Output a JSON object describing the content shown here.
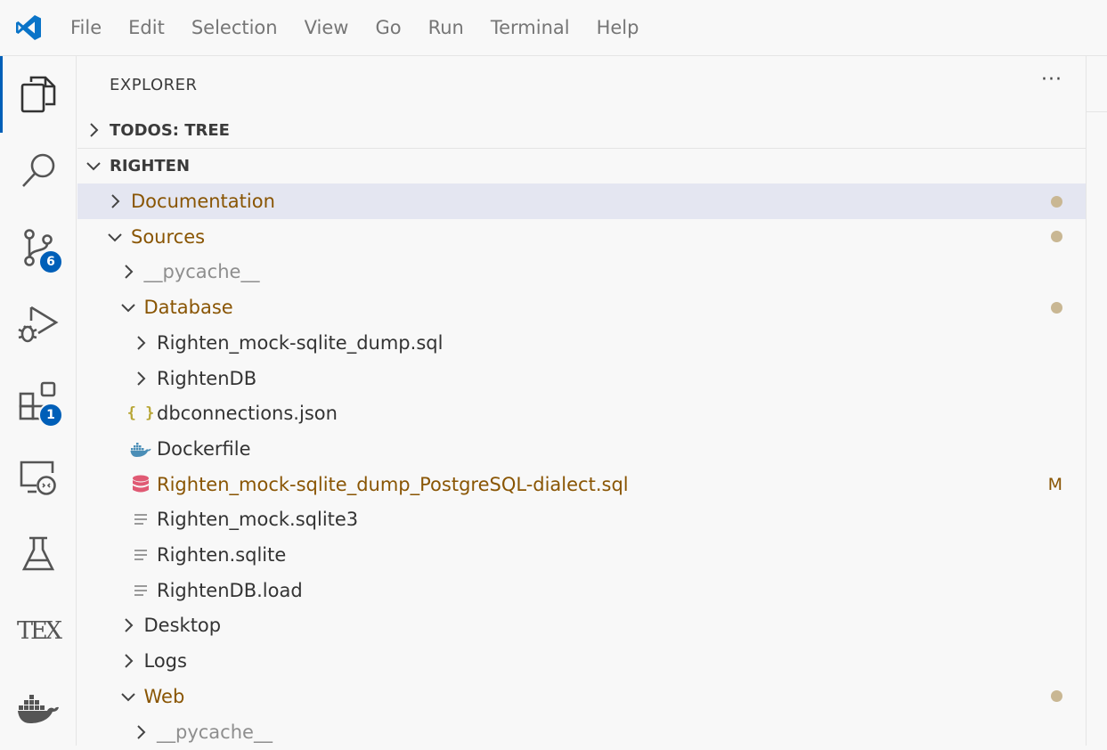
{
  "menu": [
    "File",
    "Edit",
    "Selection",
    "View",
    "Go",
    "Run",
    "Terminal",
    "Help"
  ],
  "activity": {
    "scm_badge": "6",
    "extensions_badge": "1",
    "tex_label": "TEX"
  },
  "sidebar": {
    "title": "EXPLORER",
    "more": "···",
    "sections": {
      "todos": "TODOS: TREE",
      "project": "RIGHTEN"
    }
  },
  "tree": [
    {
      "label": "Documentation",
      "kind": "folder",
      "state": "collapsed",
      "depth": 0,
      "color": "mod",
      "deco": "dot",
      "selected": true
    },
    {
      "label": "Sources",
      "kind": "folder",
      "state": "expanded",
      "depth": 0,
      "color": "mod",
      "deco": "dot"
    },
    {
      "label": "__pycache__",
      "kind": "folder",
      "state": "collapsed",
      "depth": 1,
      "color": "ignored"
    },
    {
      "label": "Database",
      "kind": "folder",
      "state": "expanded",
      "depth": 1,
      "color": "mod",
      "deco": "dot"
    },
    {
      "label": "Righten_mock-sqlite_dump.sql",
      "kind": "folder",
      "state": "collapsed",
      "depth": 2,
      "color": "normal"
    },
    {
      "label": "RightenDB",
      "kind": "folder",
      "state": "collapsed",
      "depth": 2,
      "color": "normal"
    },
    {
      "label": "dbconnections.json",
      "kind": "file",
      "icon": "json-icon",
      "depth": 2,
      "color": "normal"
    },
    {
      "label": "Dockerfile",
      "kind": "file",
      "icon": "docker-file-icon",
      "depth": 2,
      "color": "normal"
    },
    {
      "label": "Righten_mock-sqlite_dump_PostgreSQL-dialect.sql",
      "kind": "file",
      "icon": "database-file-icon",
      "depth": 2,
      "color": "mod",
      "deco": "M"
    },
    {
      "label": "Righten_mock.sqlite3",
      "kind": "file",
      "icon": "text-file-icon",
      "depth": 2,
      "color": "normal"
    },
    {
      "label": "Righten.sqlite",
      "kind": "file",
      "icon": "text-file-icon",
      "depth": 2,
      "color": "normal"
    },
    {
      "label": "RightenDB.load",
      "kind": "file",
      "icon": "text-file-icon",
      "depth": 2,
      "color": "normal"
    },
    {
      "label": "Desktop",
      "kind": "folder",
      "state": "collapsed",
      "depth": 1,
      "color": "normal"
    },
    {
      "label": "Logs",
      "kind": "folder",
      "state": "collapsed",
      "depth": 1,
      "color": "normal"
    },
    {
      "label": "Web",
      "kind": "folder",
      "state": "expanded",
      "depth": 1,
      "color": "mod",
      "deco": "dot"
    },
    {
      "label": "__pycache__",
      "kind": "folder",
      "state": "collapsed",
      "depth": 2,
      "color": "ignored"
    }
  ],
  "colors": {
    "accent": "#005fb8",
    "modified": "#895503",
    "ignored": "#8e8e8e",
    "selection": "#e4e6f1",
    "dot": "#c9b793",
    "database": "#e05a74",
    "json": "#b8a636",
    "docker": "#4a8eb7"
  }
}
